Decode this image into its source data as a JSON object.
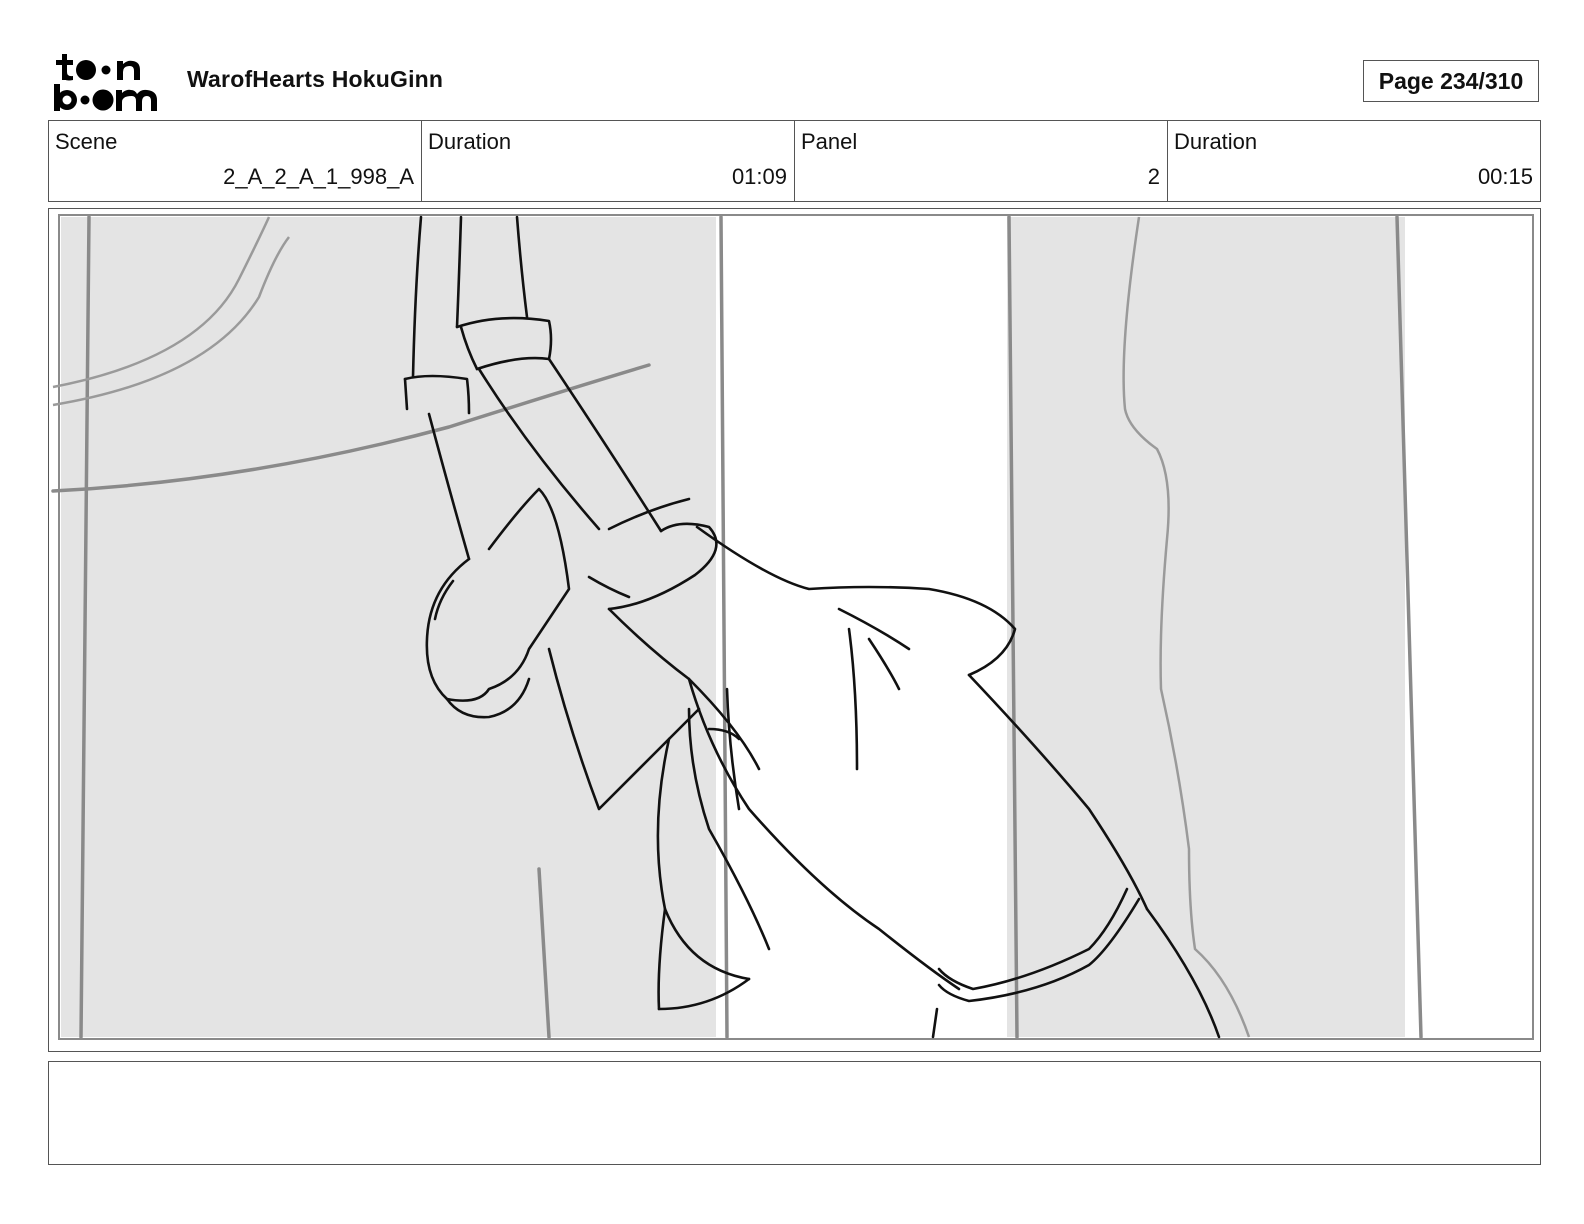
{
  "header": {
    "logo_text": "toon boom",
    "project_title": "WarofHearts HokuGinn",
    "page_label": "Page 234/310"
  },
  "info": {
    "scene_label": "Scene",
    "scene_value": "2_A_2_A_1_998_A",
    "scene_duration_label": "Duration",
    "scene_duration_value": "01:09",
    "panel_label": "Panel",
    "panel_value": "2",
    "panel_duration_label": "Duration",
    "panel_duration_value": "00:15"
  },
  "caption": {
    "text": ""
  },
  "colors": {
    "background_grey": "#e4e4e4",
    "sketch_line": "#111111",
    "background_line": "#8a8a8a"
  }
}
